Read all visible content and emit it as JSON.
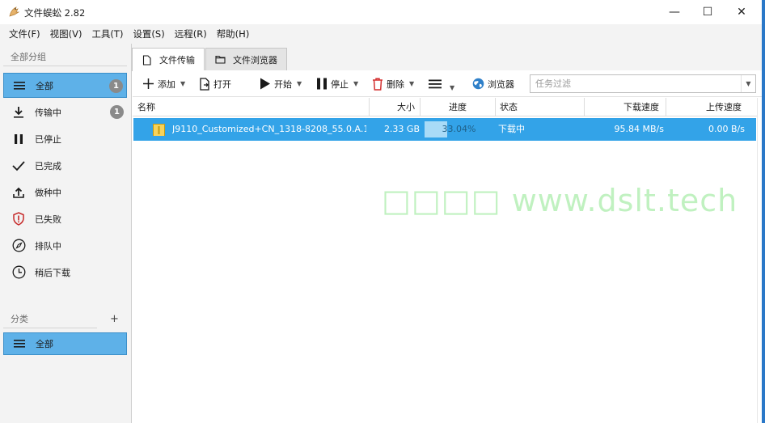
{
  "window": {
    "title": "文件蜈蚣 2.82",
    "controls": {
      "minimize": "—",
      "maximize": "☐",
      "close": "✕"
    }
  },
  "menu": [
    "文件(F)",
    "视图(V)",
    "工具(T)",
    "设置(S)",
    "远程(R)",
    "帮助(H)"
  ],
  "sidebar": {
    "groups_title": "全部分组",
    "items": [
      {
        "label": "全部",
        "icon": "list-icon",
        "count": "1",
        "active": true
      },
      {
        "label": "传输中",
        "icon": "download-icon",
        "count": "1"
      },
      {
        "label": "已停止",
        "icon": "pause-icon"
      },
      {
        "label": "已完成",
        "icon": "check-icon"
      },
      {
        "label": "做种中",
        "icon": "upload-icon"
      },
      {
        "label": "已失败",
        "icon": "shield-alert-icon"
      },
      {
        "label": "排队中",
        "icon": "compass-icon"
      },
      {
        "label": "稍后下载",
        "icon": "clock-icon"
      }
    ],
    "categories_title": "分类",
    "add_category": "+",
    "category_items": [
      {
        "label": "全部",
        "icon": "list-icon",
        "active": true
      }
    ]
  },
  "tabs": [
    {
      "label": "文件传输",
      "icon": "file-icon",
      "active": true
    },
    {
      "label": "文件浏览器",
      "icon": "folder-icon",
      "active": false
    }
  ],
  "toolbar": {
    "add": "添加",
    "open": "打开",
    "start": "开始",
    "stop": "停止",
    "delete": "删除",
    "browser": "浏览器",
    "filter_placeholder": "任务过滤",
    "filter_value": ""
  },
  "table": {
    "columns": [
      "名称",
      "大小",
      "进度",
      "状态",
      "下载速度",
      "上传速度"
    ],
    "rows": [
      {
        "name": "J9110_Customized+CN_1318-8208_55.0.A.1...",
        "size": "2.33 GB",
        "progress_text": "33.04%",
        "progress": 0.3304,
        "status": "下载中",
        "down_speed": "95.84 MB/s",
        "up_speed": "0.00 B/s"
      }
    ]
  },
  "watermark": "□□□□ www.dslt.tech",
  "colors": {
    "selection": "#33a3e8",
    "sidebar_active": "#5eb1e8",
    "progress_fill": "#a9dbf7",
    "watermark": "#8ee68e"
  }
}
